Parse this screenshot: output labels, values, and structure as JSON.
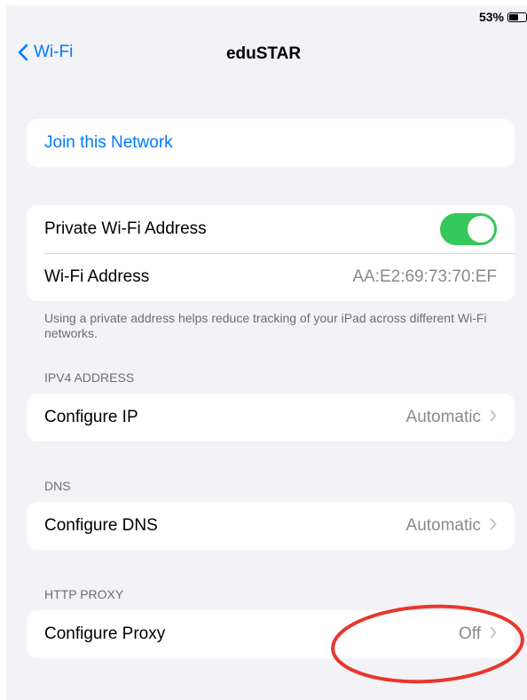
{
  "status_bar": {
    "battery_percent": "53%",
    "battery_level": 0.53
  },
  "nav": {
    "back_label": "Wi-Fi",
    "title": "eduSTAR"
  },
  "join": {
    "label": "Join this Network"
  },
  "private_address": {
    "toggle_label": "Private Wi-Fi Address",
    "toggle_on": true,
    "address_label": "Wi-Fi Address",
    "address_value": "AA:E2:69:73:70:EF",
    "footnote": "Using a private address helps reduce tracking of your iPad across different Wi-Fi networks."
  },
  "ipv4": {
    "header": "IPV4 ADDRESS",
    "label": "Configure IP",
    "value": "Automatic"
  },
  "dns": {
    "header": "DNS",
    "label": "Configure DNS",
    "value": "Automatic"
  },
  "proxy": {
    "header": "HTTP PROXY",
    "label": "Configure Proxy",
    "value": "Off"
  },
  "icons": {
    "back": "chevron-left-icon",
    "disclosure": "chevron-right-icon",
    "battery": "battery-icon"
  },
  "colors": {
    "accent": "#007aff",
    "toggle_on": "#34c759",
    "annotation": "#e8372c",
    "background": "#f2f2f7"
  }
}
